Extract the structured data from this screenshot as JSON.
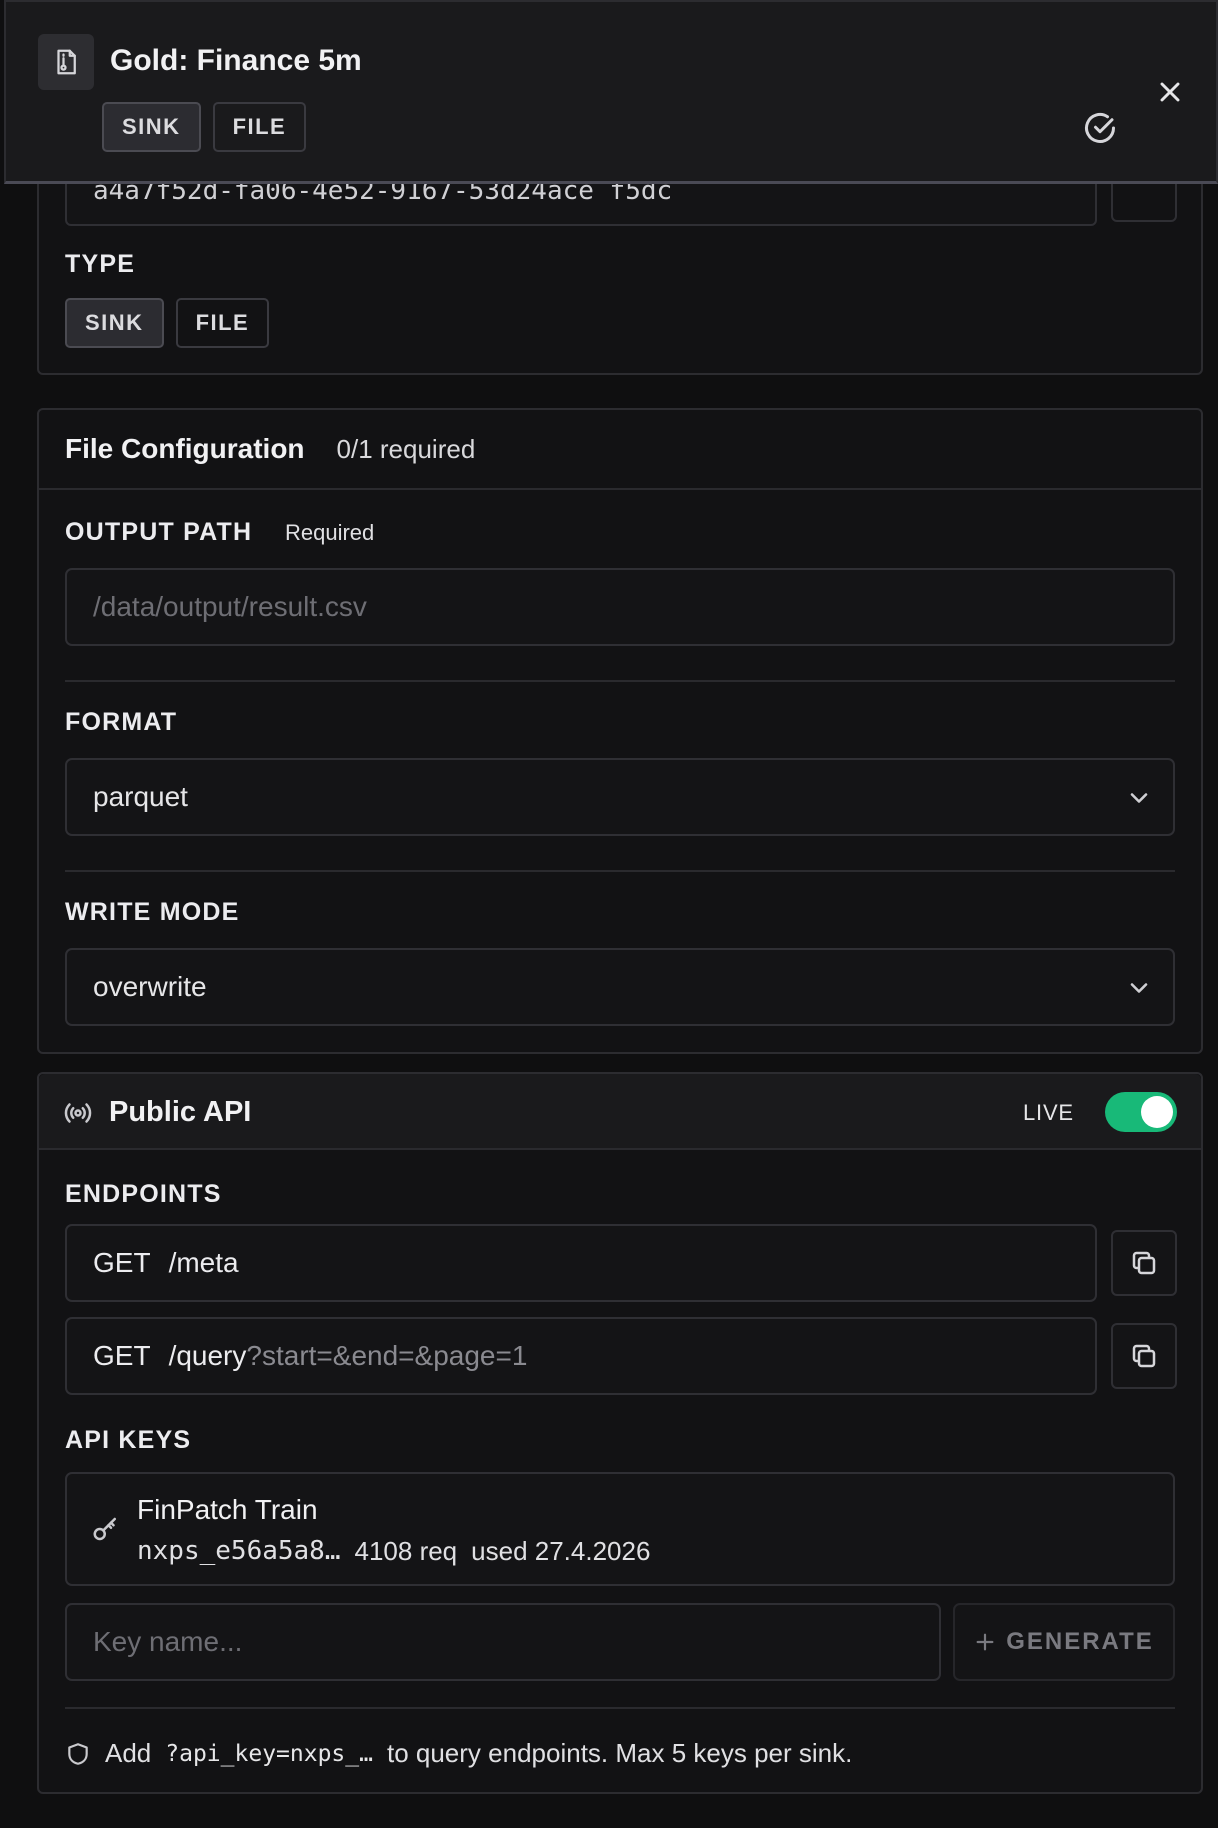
{
  "header": {
    "title": "Gold: Finance 5m",
    "tags": [
      "SINK",
      "FILE"
    ]
  },
  "identity": {
    "id_value": "a4a7f52d-fa06-4e52-9167-53d24ace f5dc"
  },
  "type_section": {
    "label": "TYPE",
    "options": [
      "SINK",
      "FILE"
    ],
    "selected": "SINK"
  },
  "file_config": {
    "title": "File Configuration",
    "progress": "0/1 required",
    "output_path": {
      "label": "OUTPUT PATH",
      "required_text": "Required",
      "placeholder": "/data/output/result.csv"
    },
    "format": {
      "label": "FORMAT",
      "value": "parquet"
    },
    "write_mode": {
      "label": "WRITE MODE",
      "value": "overwrite"
    }
  },
  "public_api": {
    "title": "Public API",
    "status_label": "LIVE",
    "live": true,
    "toggle_color": "#18b978",
    "endpoints_label": "ENDPOINTS",
    "endpoints": [
      {
        "method": "GET",
        "path": "/meta",
        "query": ""
      },
      {
        "method": "GET",
        "path": "/query",
        "query": "?start=&end=&page=1"
      }
    ],
    "api_keys_label": "API KEYS",
    "keys": [
      {
        "name": "FinPatch Train",
        "prefix": "nxps_e56a5a8…",
        "requests": "4108 req",
        "last_used": "used 27.4.2026"
      }
    ],
    "key_name_placeholder": "Key name...",
    "generate_label": "GENERATE",
    "footnote": {
      "prefix": "Add",
      "code": "?api_key=nxps_…",
      "suffix": "to query endpoints. Max 5 keys per sink."
    }
  }
}
